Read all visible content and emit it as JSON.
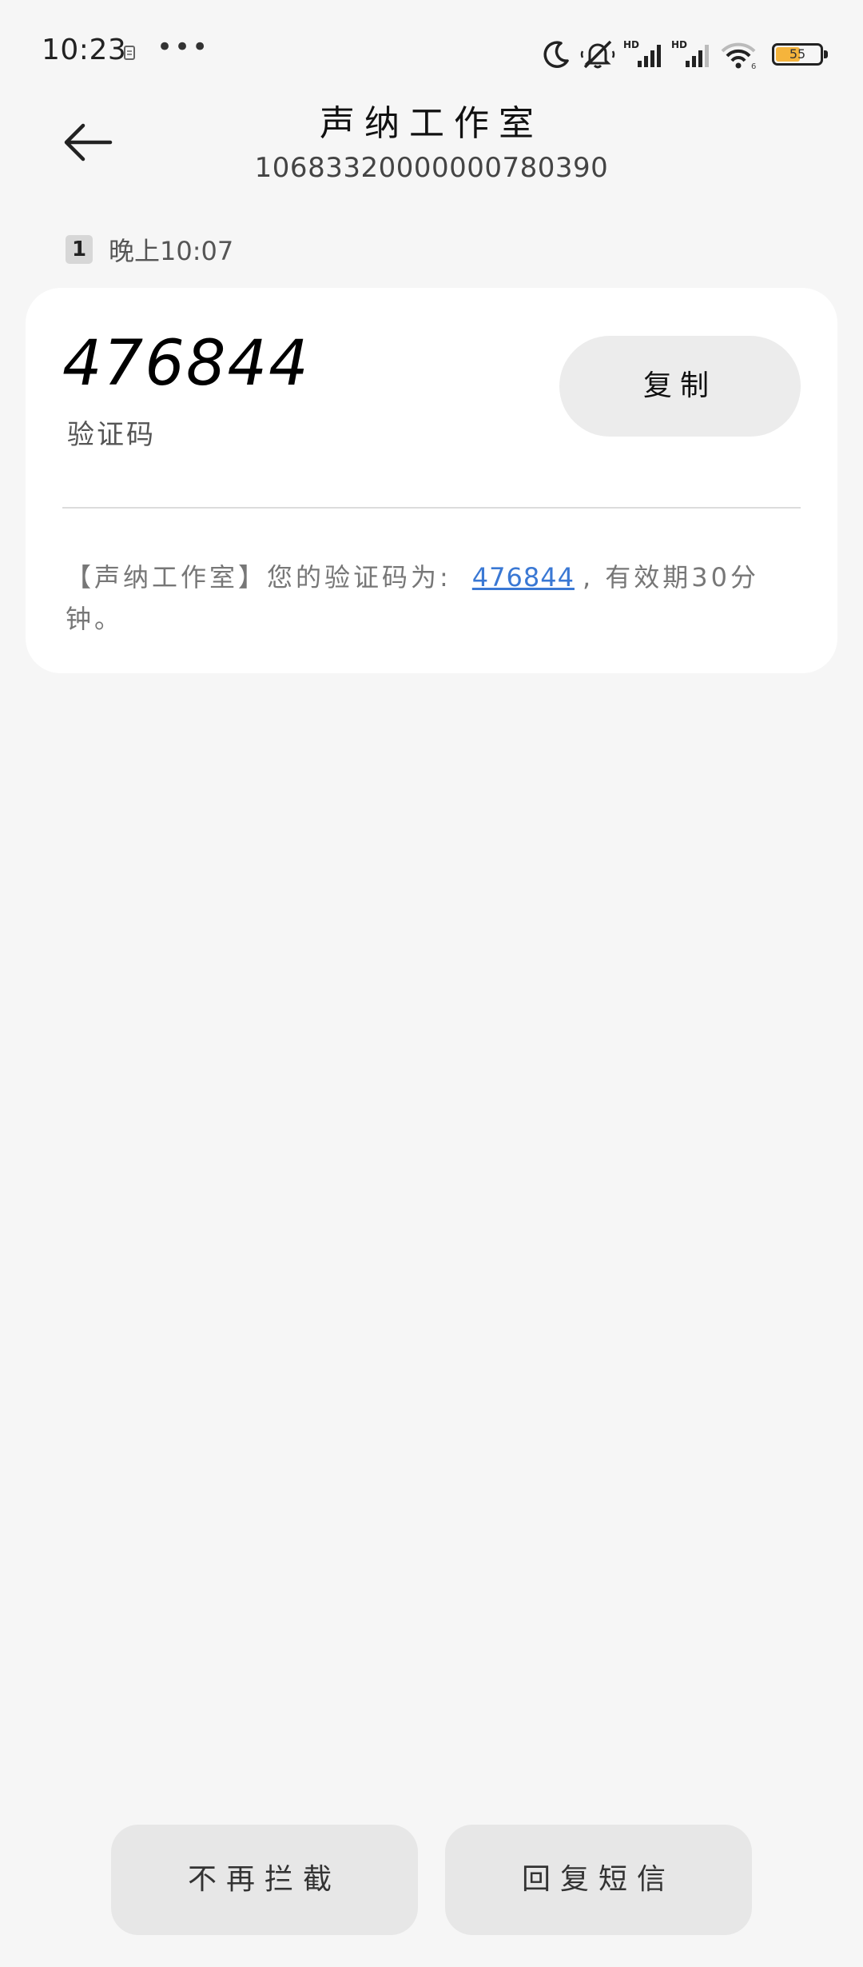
{
  "status_bar": {
    "time": "10:23",
    "more": "•••",
    "battery_level": "55",
    "battery_fraction": 0.55,
    "icons": [
      "notification-app-icon",
      "moon-icon",
      "mute-icon",
      "hd-signal-icon",
      "hd-signal-icon",
      "wifi-icon",
      "battery-icon"
    ],
    "battery_color": "#f5b43c"
  },
  "header": {
    "back_icon": "arrow-left-icon",
    "title": "声纳工作室",
    "sender_number": "10683320000000780390"
  },
  "timestamp": {
    "sim_badge": "1",
    "time_text": "晚上10:07"
  },
  "message_card": {
    "code": "476844",
    "code_label": "验证码",
    "copy_label": "复制",
    "body_prefix": "【声纳工作室】您的验证码为:",
    "body_code": "476844",
    "body_suffix": ", 有效期30分钟。",
    "link_color": "#3a78d4"
  },
  "actions": {
    "stop_blocking_label": "不再拦截",
    "reply_label": "回复短信"
  }
}
